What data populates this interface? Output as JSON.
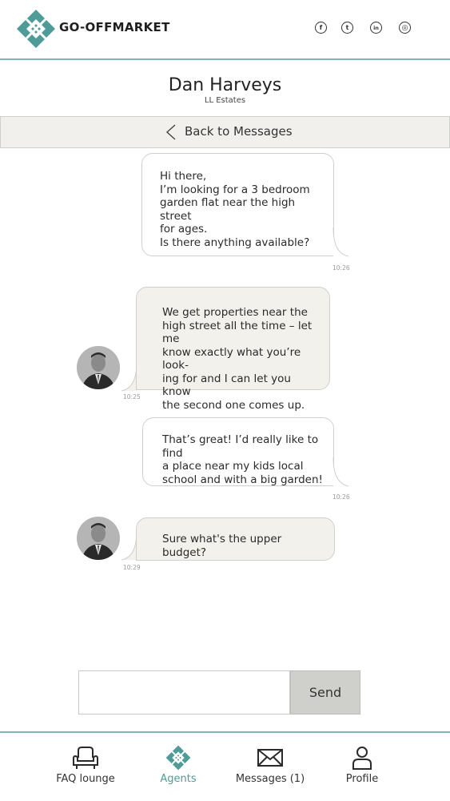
{
  "brand": {
    "name": "GO-OFFMARKET",
    "accent": "#4e9b97",
    "divider": "#7fb5b7"
  },
  "social": [
    {
      "icon": "facebook-icon",
      "glyph": "f"
    },
    {
      "icon": "twitter-icon",
      "glyph": "t"
    },
    {
      "icon": "linkedin-icon",
      "glyph": "in"
    },
    {
      "icon": "instagram-icon",
      "glyph": "◎"
    }
  ],
  "contact": {
    "name": "Dan Harveys",
    "company": "LL Estates"
  },
  "back": {
    "label": "Back to Messages"
  },
  "messages": [
    {
      "from": "user",
      "text": "Hi there,\nI’m looking for a 3 bedroom\ngarden flat near the high street\nfor ages.\nIs there anything available?",
      "time": "10:26"
    },
    {
      "from": "agent",
      "text": "We get properties near the\nhigh street all the time – let me\nknow exactly what you’re look-\ning for and I can let you know\nthe second one comes up.",
      "time": "10:25"
    },
    {
      "from": "user",
      "text": "That’s great! I’d really like to find\na place near my kids local\nschool and with a big garden!",
      "time": "10:26"
    },
    {
      "from": "agent",
      "text": "Sure what's the upper budget?",
      "time": "10:29"
    }
  ],
  "composer": {
    "value": "",
    "placeholder": "",
    "send_label": "Send"
  },
  "nav": {
    "items": [
      {
        "label": "FAQ lounge",
        "icon": "armchair-icon",
        "active": false
      },
      {
        "label": "Agents",
        "icon": "diamond-logo-icon",
        "active": true
      },
      {
        "label": "Messages (1)",
        "icon": "envelope-icon",
        "active": false
      },
      {
        "label": "Profile",
        "icon": "person-icon",
        "active": false
      }
    ]
  },
  "colors": {
    "agent_bubble": "#f3f1ec",
    "user_bubble": "#ffffff",
    "back_bar": "#f1f0ec",
    "send_button": "#cfcfcc"
  }
}
